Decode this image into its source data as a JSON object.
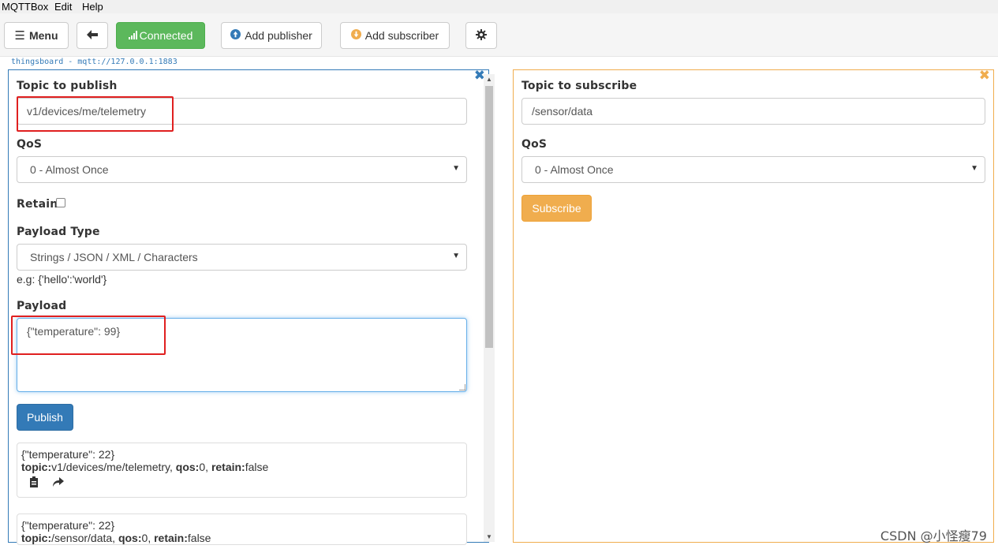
{
  "menubar": {
    "items": [
      "MQTTBox",
      "Edit",
      "Help"
    ]
  },
  "toolbar": {
    "menu_label": "Menu",
    "connected_label": "Connected",
    "add_publisher_label": "Add publisher",
    "add_subscriber_label": "Add subscriber"
  },
  "connection": {
    "label": "thingsboard - mqtt://127.0.0.1:1883"
  },
  "publisher": {
    "topic_label": "Topic to publish",
    "topic_value": "v1/devices/me/telemetry",
    "qos_label": "QoS",
    "qos_value": "0 - Almost Once",
    "retain_label": "Retain",
    "payload_type_label": "Payload Type",
    "payload_type_value": "Strings / JSON / XML / Characters",
    "payload_hint": "e.g: {'hello':'world'}",
    "payload_label": "Payload",
    "payload_value": "{\"temperature\": 99}",
    "publish_button": "Publish",
    "messages": [
      {
        "payload": "{\"temperature\": 22}",
        "topic_key": "topic:",
        "topic": "v1/devices/me/telemetry",
        "qos_key": "qos:",
        "qos": "0",
        "retain_key": "retain:",
        "retain": "false"
      },
      {
        "payload": "{\"temperature\": 22}",
        "topic_key": "topic:",
        "topic": "/sensor/data",
        "qos_key": "qos:",
        "qos": "0",
        "retain_key": "retain:",
        "retain": "false"
      }
    ]
  },
  "subscriber": {
    "topic_label": "Topic to subscribe",
    "topic_value": "/sensor/data",
    "qos_label": "QoS",
    "qos_value": "0 - Almost Once",
    "subscribe_button": "Subscribe"
  },
  "watermark": "CSDN @小怪瘦79",
  "colors": {
    "primary": "#337ab7",
    "success": "#5cb85c",
    "warning": "#f0ad4e",
    "highlight": "#e02020"
  }
}
